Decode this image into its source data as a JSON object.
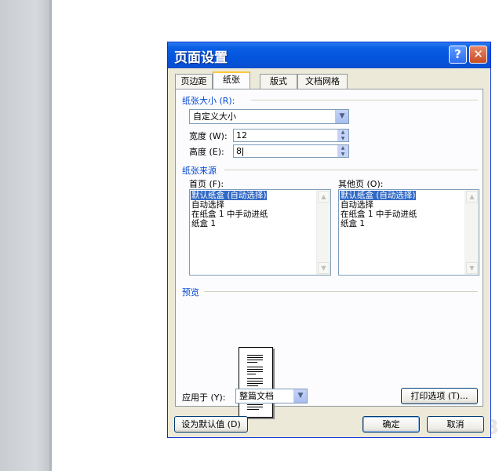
{
  "dialog": {
    "title": "页面设置",
    "help_glyph": "?",
    "close_glyph": "✕"
  },
  "tabs": [
    {
      "label": "页边距",
      "active": false
    },
    {
      "label": "纸张",
      "active": true
    },
    {
      "label": "版式",
      "active": false
    },
    {
      "label": "文档网格",
      "active": false
    }
  ],
  "paper_size": {
    "group_label": "纸张大小 (R):",
    "selected": "自定义大小",
    "width_label": "宽度 (W):",
    "width_value": "12",
    "height_label": "高度 (E):",
    "height_value": "8"
  },
  "paper_source": {
    "group_label": "纸张来源",
    "first_page": {
      "label": "首页 (F):",
      "items": [
        "默认纸盒 (自动选择)",
        "自动选择",
        "在纸盒 1 中手动进纸",
        "纸盒 1"
      ],
      "selected_index": 0
    },
    "other_pages": {
      "label": "其他页 (O):",
      "items": [
        "默认纸盒 (自动选择)",
        "自动选择",
        "在纸盒 1 中手动进纸",
        "纸盒 1"
      ],
      "selected_index": 0
    }
  },
  "preview": {
    "group_label": "预览",
    "apply_to_label": "应用于 (Y):",
    "apply_to_value": "整篇文档",
    "print_options_label": "打印选项 (T)..."
  },
  "footer": {
    "set_default_label": "设为默认值 (D)",
    "ok_label": "确定",
    "cancel_label": "取消"
  },
  "watermark": "B",
  "colors": {
    "titlebar": "#0454de",
    "group_label": "#0046d5",
    "selection": "#316ac5",
    "dialog_bg": "#ece9d8"
  }
}
